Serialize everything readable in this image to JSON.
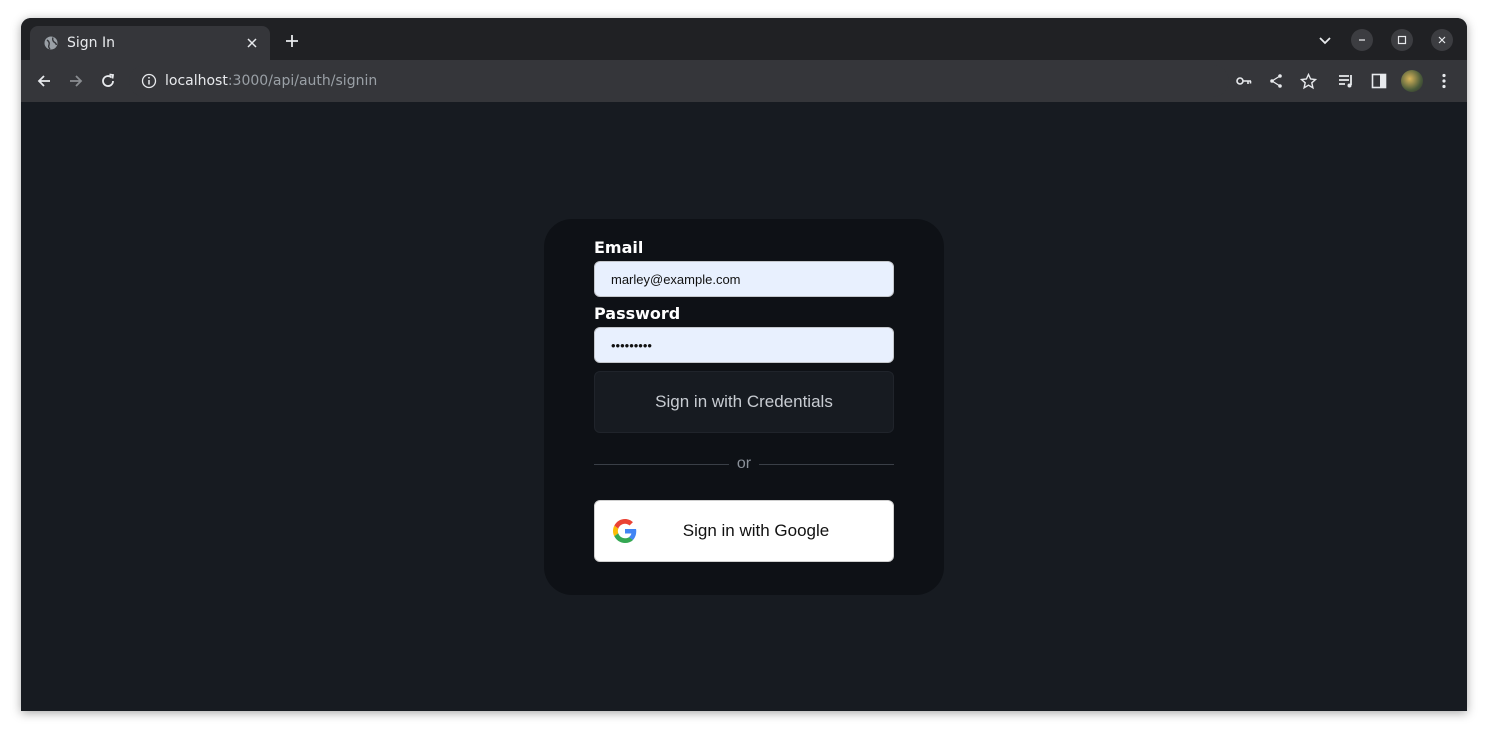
{
  "browser": {
    "tab_title": "Sign In",
    "url_host": "localhost",
    "url_rest": ":3000/api/auth/signin"
  },
  "form": {
    "email_label": "Email",
    "email_value": "marley@example.com",
    "password_label": "Password",
    "password_value": "•••••••••",
    "credentials_button": "Sign in with Credentials",
    "divider_text": "or",
    "google_button": "Sign in with Google"
  },
  "colors": {
    "page_bg": "#171b21",
    "card_bg": "#0e1116",
    "input_bg": "#e8f0fe"
  }
}
